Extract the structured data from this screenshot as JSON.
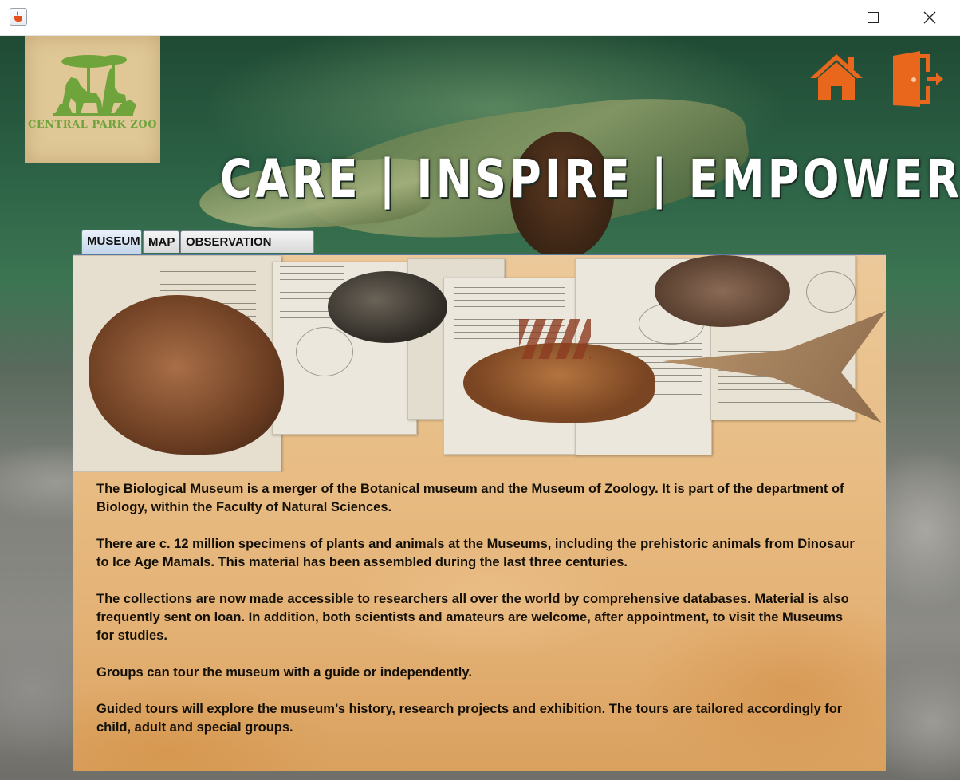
{
  "window": {
    "app_icon": "java-cup-icon",
    "controls": [
      "minimize-icon",
      "maximize-icon",
      "close-icon"
    ]
  },
  "header": {
    "logo_text": "CENTRAL PARK ZOO",
    "slogan": "CARE | INSPIRE | EMPOWER",
    "home_icon": "home-icon",
    "exit_icon": "exit-door-icon",
    "accent_color": "#e8671c"
  },
  "tabs": [
    {
      "label": "MUSEUM",
      "selected": true
    },
    {
      "label": "MAP",
      "selected": false
    },
    {
      "label": "OBSERVATION CENTER",
      "selected": false
    }
  ],
  "museum": {
    "paragraphs": [
      "The Biological Museum is a merger of the Botanical museum and the Museum of Zoology. It is part of the department of Biology, within the Faculty of Natural Sciences.",
      "There are c. 12 million specimens of plants and animals at the Museums, including the prehistoric animals from Dinosaur to Ice Age Mamals. This material has been assembled during the last three centuries.",
      "The collections are now made accessible to researchers all over the world by comprehensive databases. Material is also frequently sent on loan. In addition, both scientists and amateurs are welcome, after appointment, to visit the Museums for studies.",
      "Groups can tour the museum with a guide or independently.",
      "Guided tours will explore the museum’s history, research projects and exhibition. The tours are tailored accordingly for child, adult and special groups."
    ]
  }
}
